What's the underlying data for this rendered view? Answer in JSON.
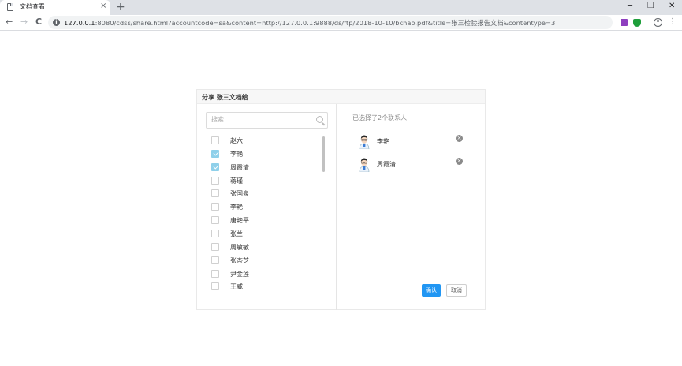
{
  "browser": {
    "tab_title": "文档查看",
    "tab_close": "×",
    "new_tab": "+",
    "minimize": "─",
    "restore": "❐",
    "close": "✕",
    "back": "←",
    "forward": "→",
    "reload": "C",
    "url_host": "127.0.0.1",
    "url_rest": ":8080/cdss/share.html?accountcode=sa&content=http://127.0.0.1:9888/ds/ftp/2018-10-10/bchao.pdf&title=张三检验报告文档&contentype=3",
    "menu": "⋮"
  },
  "dialog": {
    "title": "分享 张三文档给",
    "search_placeholder": "搜索",
    "contacts": [
      {
        "name": "赵六",
        "checked": false
      },
      {
        "name": "李艳",
        "checked": true
      },
      {
        "name": "周霞清",
        "checked": true
      },
      {
        "name": "蒋瑾",
        "checked": false
      },
      {
        "name": "张国泉",
        "checked": false
      },
      {
        "name": "李艳",
        "checked": false
      },
      {
        "name": "唐艳平",
        "checked": false
      },
      {
        "name": "张兰",
        "checked": false
      },
      {
        "name": "周敏敏",
        "checked": false
      },
      {
        "name": "张杏芝",
        "checked": false
      },
      {
        "name": "尹金莲",
        "checked": false
      },
      {
        "name": "王威",
        "checked": false
      }
    ],
    "selected_count_text": "已选择了2个联系人",
    "selected": [
      {
        "name": "李艳"
      },
      {
        "name": "周霞清"
      }
    ],
    "remove_glyph": "×",
    "confirm_label": "确认",
    "cancel_label": "取消"
  }
}
